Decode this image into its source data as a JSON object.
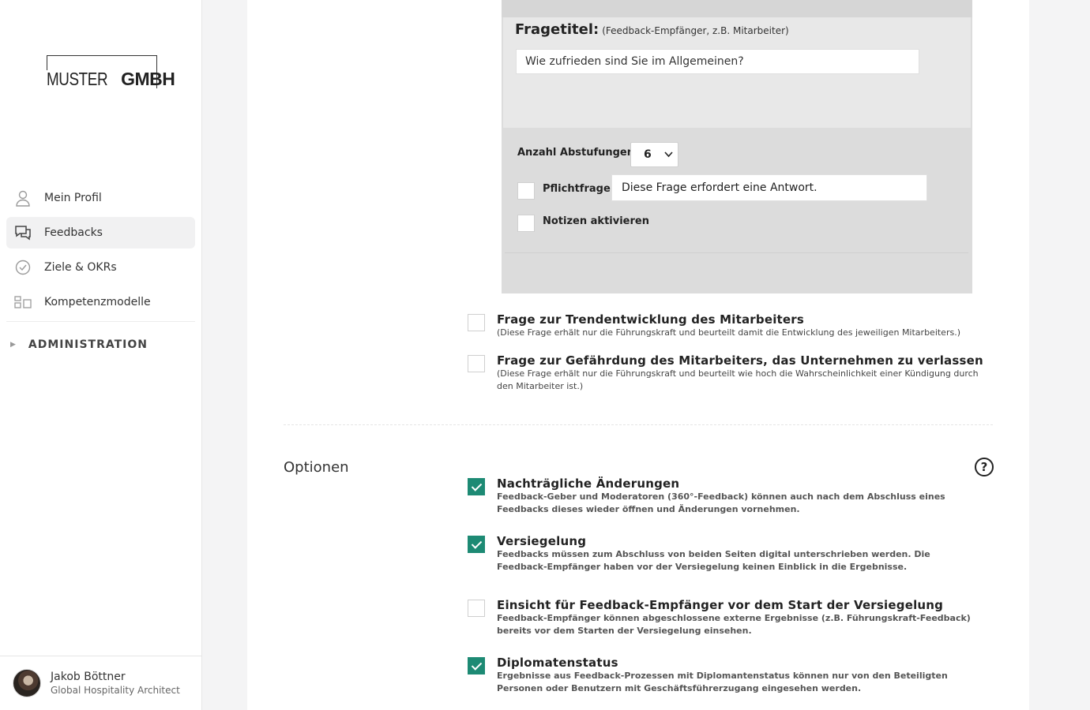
{
  "logo": {
    "light": "MUSTER",
    "bold": "GMBH"
  },
  "sidebar": {
    "items": [
      {
        "label": "Mein Profil",
        "icon": "user-icon"
      },
      {
        "label": "Feedbacks",
        "icon": "chat-icon",
        "active": true
      },
      {
        "label": "Ziele & OKRs",
        "icon": "check-circle-icon"
      },
      {
        "label": "Kompetenzmodelle",
        "icon": "grid-icon"
      }
    ],
    "admin_label": "ADMINISTRATION"
  },
  "profile": {
    "name": "Jakob Böttner",
    "role": "Global Hospitality Architect"
  },
  "question": {
    "title_label": "Fragetitel:",
    "title_hint": "(Feedback-Empfänger, z.B. Mitarbeiter)",
    "title_value": "Wie zufrieden sind Sie im Allgemeinen?",
    "steps_label": "Anzahl Abstufungen",
    "steps_value": "6",
    "required_label": "Pflichtfrage",
    "required_text": "Diese Frage erfordert eine Antwort.",
    "notes_label": "Notizen aktivieren"
  },
  "extra_questions": [
    {
      "title": "Frage zur Trendentwicklung des Mitarbeiters",
      "desc": "(Diese Frage erhält nur die Führungskraft und beurteilt damit die Entwicklung des jeweiligen Mitarbeiters.)",
      "checked": false
    },
    {
      "title": "Frage zur Gefährdung des Mitarbeiters, das Unternehmen zu verlassen",
      "desc": "(Diese Frage erhält nur die Führungskraft und beurteilt wie hoch die Wahrscheinlichkeit einer Kündigung durch den Mitarbeiter ist.)",
      "checked": false
    }
  ],
  "options_heading": "Optionen",
  "options": [
    {
      "title": "Nachträgliche Änderungen",
      "desc": "Feedback-Geber und Moderatoren (360°-Feedback) können auch nach dem Abschluss eines Feedbacks dieses wieder öffnen und Änderungen vornehmen.",
      "checked": true
    },
    {
      "title": "Versiegelung",
      "desc": "Feedbacks müssen zum Abschluss von beiden Seiten digital unterschrieben werden. Die Feedback-Empfänger haben vor der Versiegelung keinen Einblick in die Ergebnisse.",
      "checked": true
    },
    {
      "title": "Einsicht für Feedback-Empfänger vor dem Start der Versiegelung",
      "desc": "Feedback-Empfänger können abgeschlossene externe Ergebnisse (z.B. Führungskraft-Feedback) bereits vor dem Starten der Versiegelung einsehen.",
      "checked": false
    },
    {
      "title": "Diplomatenstatus",
      "desc": "Ergebnisse aus Feedback-Prozessen mit Diplomantenstatus können nur von den Beteiligten Personen oder Benutzern mit Geschäftsführerzugang eingesehen werden.",
      "checked": true
    }
  ],
  "colors": {
    "accent": "#1d8a74",
    "panel": "#dcdcdc"
  }
}
